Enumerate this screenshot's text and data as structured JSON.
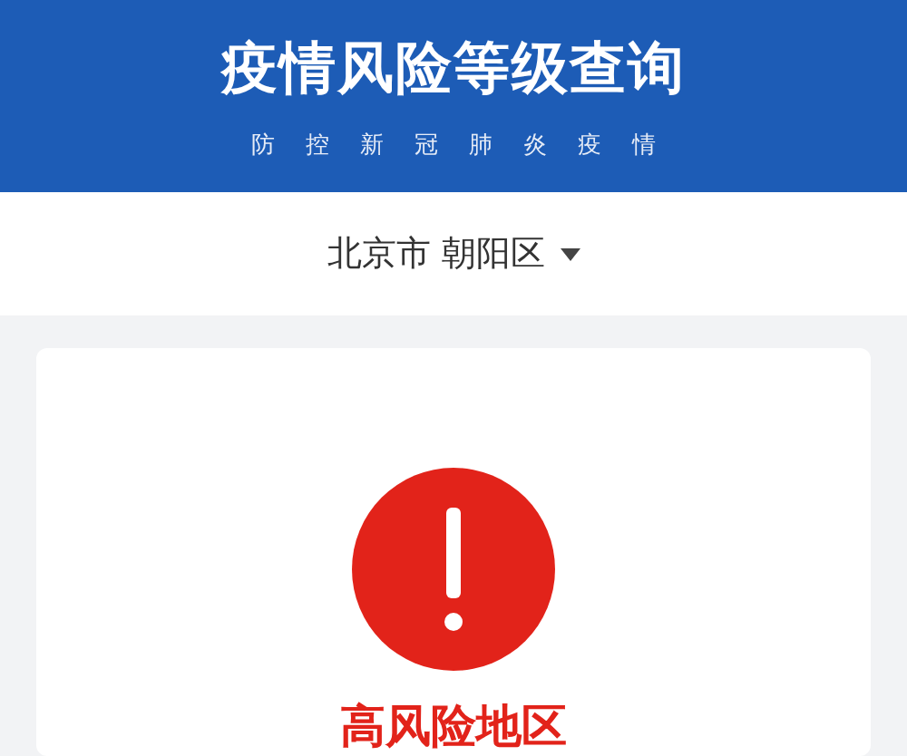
{
  "header": {
    "title": "疫情风险等级查询",
    "subtitle": "防控新冠肺炎疫情"
  },
  "location": {
    "city": "北京市",
    "district": "朝阳区"
  },
  "result": {
    "kind": "high",
    "label": "高风险地区"
  }
}
